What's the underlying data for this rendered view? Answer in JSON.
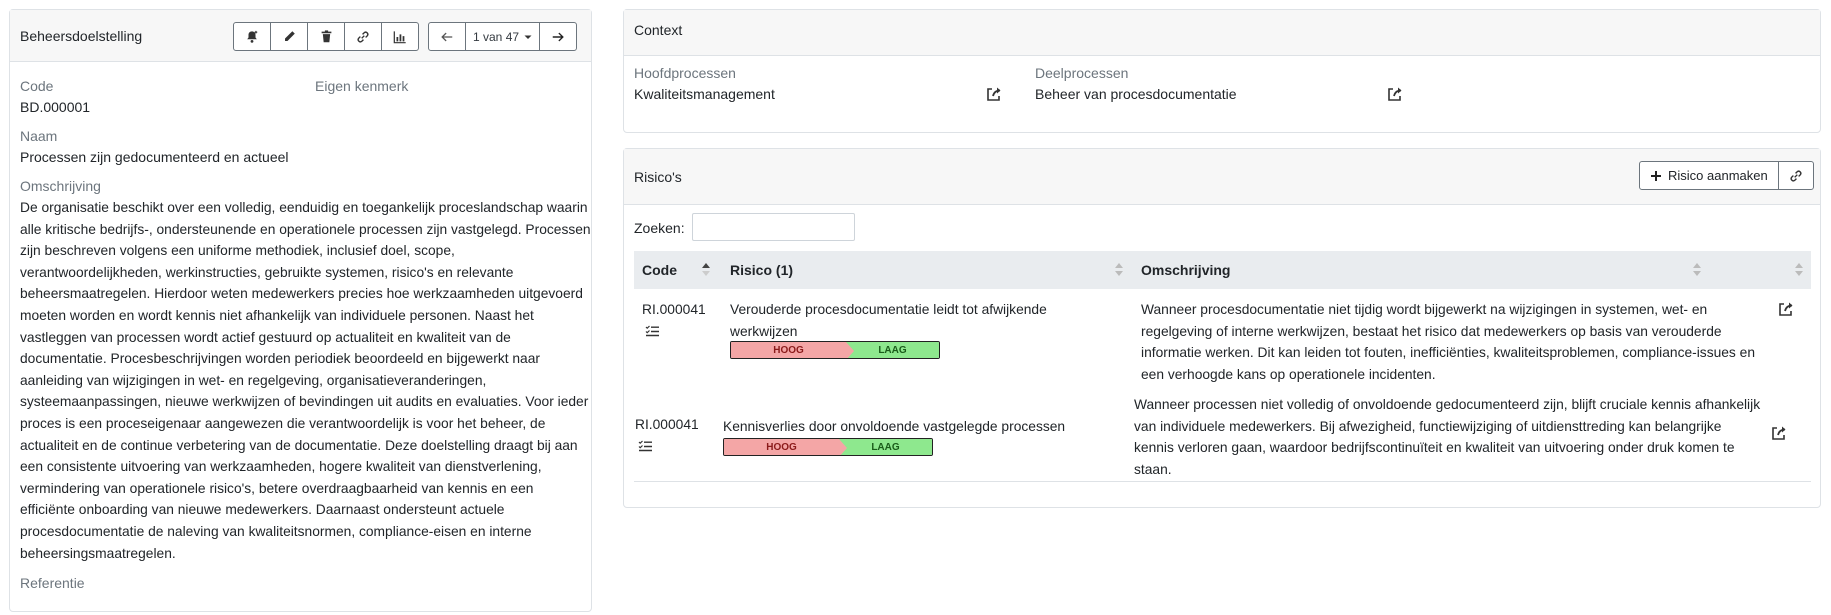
{
  "left": {
    "header_title": "Beheersdoelstelling",
    "pager_label": "1 van 47",
    "code_label": "Code",
    "code_value": "BD.000001",
    "own_mark_label": "Eigen kenmerk",
    "name_label": "Naam",
    "name_value": "Processen zijn gedocumenteerd en actueel",
    "description_label": "Omschrijving",
    "description_value": "De organisatie beschikt over een volledig, eenduidig en toegankelijk proceslandschap waarin alle kritische bedrijfs-, ondersteunende en operationele processen zijn vastgelegd. Processen zijn beschreven volgens een uniforme methodiek, inclusief doel, scope, verantwoordelijkheden, werkinstructies, gebruikte systemen, risico's en relevante beheersmaatregelen. Hierdoor weten medewerkers precies hoe werkzaamheden uitgevoerd moeten worden en wordt kennis niet afhankelijk van individuele personen. Naast het vastleggen van processen wordt actief gestuurd op actualiteit en kwaliteit van de documentatie. Procesbeschrijvingen worden periodiek beoordeeld en bijgewerkt naar aanleiding van wijzigingen in wet- en regelgeving, organisatieveranderingen, systeemaanpassingen, nieuwe werkwijzen of bevindingen uit audits en evaluaties. Voor ieder proces is een proceseigenaar aangewezen die verantwoordelijk is voor het beheer, de actualiteit en de continue verbetering van de documentatie. Deze doelstelling draagt bij aan een consistente uitvoering van werkzaamheden, hogere kwaliteit van dienstverlening, vermindering van operationele risico's, betere overdraagbaarheid van kennis en een efficiënte onboarding van nieuwe medewerkers. Daarnaast ondersteunt actuele procesdocumentatie de naleving van kwaliteitsnormen, compliance-eisen en interne beheersingsmaatregelen.",
    "reference_label": "Referentie"
  },
  "context": {
    "header_title": "Context",
    "main_processes_label": "Hoofdprocessen",
    "main_processes_value": "Kwaliteitsmanagement",
    "sub_processes_label": "Deelprocessen",
    "sub_processes_value": "Beheer van procesdocumentatie"
  },
  "risks": {
    "header_title": "Risico's",
    "create_button_label": "Risico aanmaken",
    "search_label": "Zoeken:",
    "columns": [
      "Code",
      "Risico (1)",
      "Omschrijving"
    ],
    "rows": [
      {
        "code": "RI.000041",
        "title": "Verouderde procesdocumentatie leidt tot afwijkende werkwijzen",
        "gross": "HOOG",
        "net": "LAAG",
        "description": "Wanneer procesdocumentatie niet tijdig wordt bijgewerkt na wijzigingen in systemen, wet- en regelgeving of interne werkwijzen, bestaat het risico dat medewerkers op basis van verouderde informatie werken. Dit kan leiden tot fouten, inefficiënties, kwaliteitsproblemen, compliance-issues en een verhoogde kans op operationele incidenten."
      },
      {
        "code": "RI.000041",
        "title": "Kennisverlies door onvoldoende vastgelegde processen",
        "gross": "HOOG",
        "net": "LAAG",
        "description": "Wanneer processen niet volledig of onvoldoende gedocumenteerd zijn, blijft cruciale kennis afhankelijk van individuele medewerkers. Bij afwezigheid, functiewijziging of uitdiensttreding kan belangrijke kennis verloren gaan, waardoor bedrijfscontinuïteit en kwaliteit van uitvoering onder druk komen te staan."
      }
    ]
  }
}
